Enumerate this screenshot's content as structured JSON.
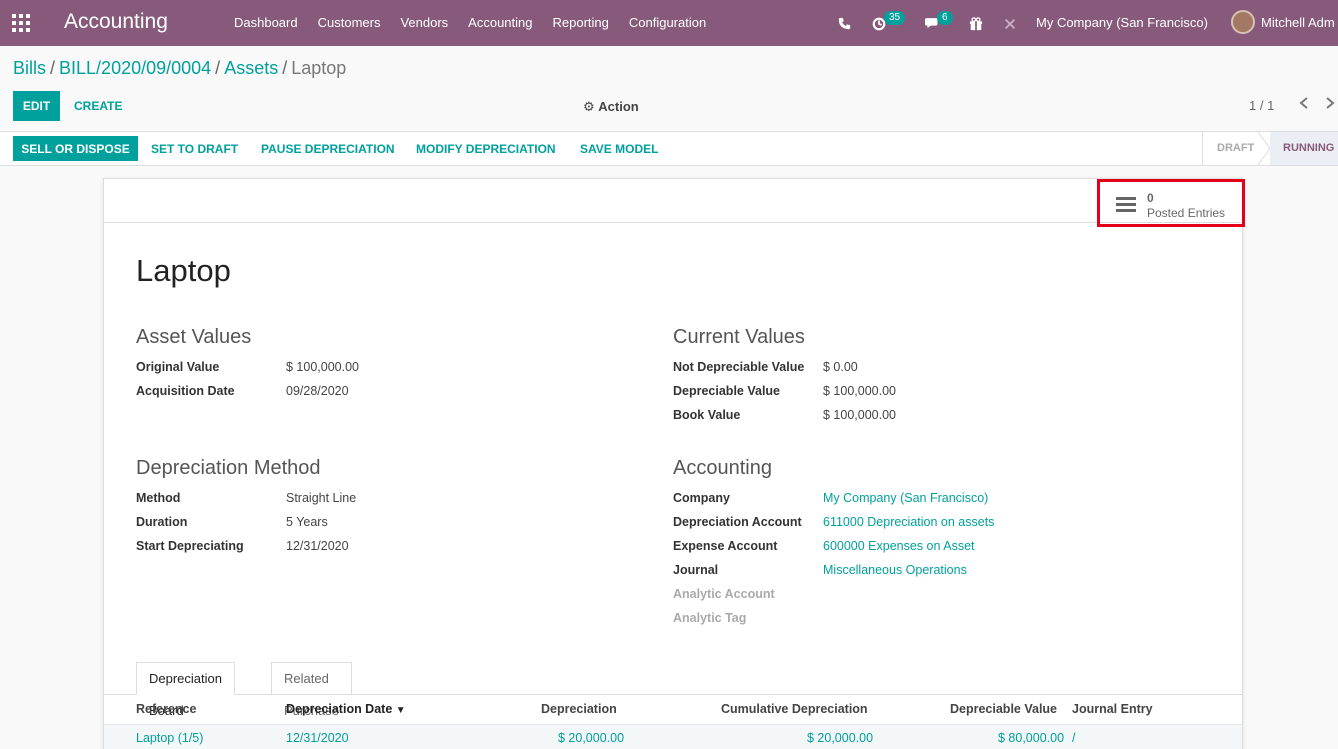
{
  "topbar": {
    "brand": "Accounting",
    "menu": [
      "Dashboard",
      "Customers",
      "Vendors",
      "Accounting",
      "Reporting",
      "Configuration"
    ],
    "activity_badge": "35",
    "messages_badge": "6",
    "company": "My Company (San Francisco)",
    "user": "Mitchell Adm"
  },
  "breadcrumb": {
    "items": [
      "Bills",
      "BILL/2020/09/0004",
      "Assets"
    ],
    "current": "Laptop"
  },
  "controls": {
    "edit": "EDIT",
    "create": "CREATE",
    "action": "Action",
    "pager": "1 / 1"
  },
  "header_buttons": {
    "sell": "SELL OR DISPOSE",
    "set_draft": "SET TO DRAFT",
    "pause": "PAUSE DEPRECIATION",
    "modify": "MODIFY DEPRECIATION",
    "save_model": "SAVE MODEL"
  },
  "status": {
    "draft": "DRAFT",
    "running": "RUNNING"
  },
  "smart_button": {
    "value": "0",
    "label": "Posted Entries"
  },
  "asset": {
    "name": "Laptop",
    "asset_values_title": "Asset Values",
    "original_value_label": "Original Value",
    "original_value": "$ 100,000.00",
    "acquisition_date_label": "Acquisition Date",
    "acquisition_date": "09/28/2020",
    "current_values_title": "Current Values",
    "not_depreciable_label": "Not Depreciable Value",
    "not_depreciable": "$ 0.00",
    "depreciable_label": "Depreciable Value",
    "depreciable": "$ 100,000.00",
    "book_value_label": "Book Value",
    "book_value": "$ 100,000.00",
    "depreciation_method_title": "Depreciation Method",
    "method_label": "Method",
    "method": "Straight Line",
    "duration_label": "Duration",
    "duration_count": "5",
    "duration_unit": "Years",
    "start_label": "Start Depreciating",
    "start": "12/31/2020",
    "accounting_title": "Accounting",
    "company_label": "Company",
    "company": "My Company (San Francisco)",
    "dep_account_label": "Depreciation Account",
    "dep_account": "611000 Depreciation on assets",
    "exp_account_label": "Expense Account",
    "exp_account": "600000 Expenses on Asset",
    "journal_label": "Journal",
    "journal": "Miscellaneous Operations",
    "analytic_account_label": "Analytic Account",
    "analytic_tag_label": "Analytic Tag"
  },
  "tabs": {
    "board": "Depreciation Board",
    "purchase": "Related Purchase"
  },
  "table": {
    "headers": [
      "Reference",
      "Depreciation Date",
      "Depreciation",
      "Cumulative Depreciation",
      "Depreciable Value",
      "Journal Entry"
    ],
    "rows": [
      {
        "reference": "Laptop (1/5)",
        "date": "12/31/2020",
        "depreciation": "$ 20,000.00",
        "cumulative": "$ 20,000.00",
        "depreciable": "$ 80,000.00",
        "journal": "/"
      }
    ]
  },
  "colors": {
    "brand": "#875a7b",
    "accent": "#00a09d",
    "highlight": "#e2001a"
  }
}
